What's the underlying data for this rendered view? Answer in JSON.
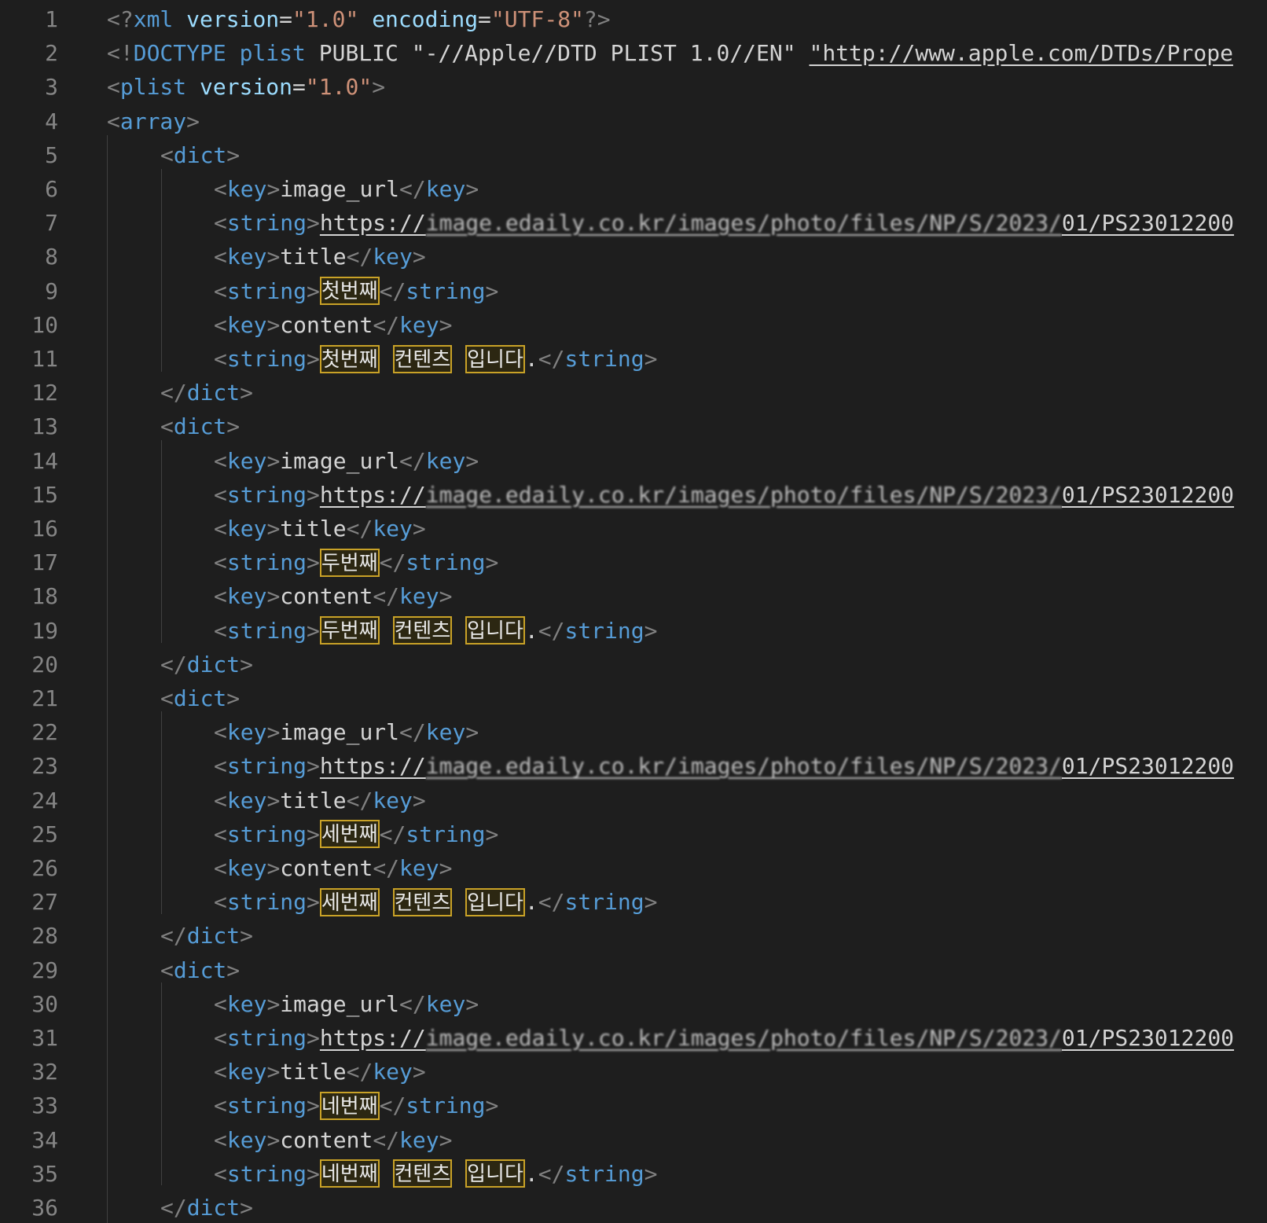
{
  "editor": {
    "language": "xml",
    "colors": {
      "background": "#1e1e1e",
      "line_number": "#858585",
      "tag_bracket": "#808080",
      "tag_name": "#569cd6",
      "attribute_name": "#9cdcfe",
      "attribute_value": "#ce9178",
      "text": "#d4d4d4",
      "unicode_highlight_border": "#c9a227"
    },
    "line_numbers": [
      "1",
      "2",
      "3",
      "4",
      "5",
      "6",
      "7",
      "8",
      "9",
      "10",
      "11",
      "12",
      "13",
      "14",
      "15",
      "16",
      "17",
      "18",
      "19",
      "20",
      "21",
      "22",
      "23",
      "24",
      "25",
      "26",
      "27",
      "28",
      "29",
      "30",
      "31",
      "32",
      "33",
      "34",
      "35",
      "36"
    ],
    "header": {
      "xml_decl": {
        "version": "1.0",
        "encoding": "UTF-8"
      },
      "doctype_public": "\"-//Apple//DTD PLIST 1.0//EN\"",
      "doctype_url": "\"http://www.apple.com/DTDs/Prope",
      "plist_version": "1.0"
    },
    "keys": {
      "image_url": "image_url",
      "title": "title",
      "content": "content"
    },
    "entries": [
      {
        "url_start": "https://",
        "url_blurred": "image.edaily.co.kr/images/photo/files/NP/S/2023/",
        "url_end": "01/PS23012200",
        "title": "첫번째",
        "content_words": [
          "첫번째",
          "컨텐츠",
          "입니다"
        ],
        "content_end": "."
      },
      {
        "url_start": "https://",
        "url_blurred": "image.edaily.co.kr/images/photo/files/NP/S/2023/",
        "url_end": "01/PS23012200",
        "title": "두번째",
        "content_words": [
          "두번째",
          "컨텐츠",
          "입니다"
        ],
        "content_end": "."
      },
      {
        "url_start": "https://",
        "url_blurred": "image.edaily.co.kr/images/photo/files/NP/S/2023/",
        "url_end": "01/PS23012200",
        "title": "세번째",
        "content_words": [
          "세번째",
          "컨텐츠",
          "입니다"
        ],
        "content_end": "."
      },
      {
        "url_start": "https://",
        "url_blurred": "image.edaily.co.kr/images/photo/files/NP/S/2023/",
        "url_end": "01/PS23012200",
        "title": "네번째",
        "content_words": [
          "네번째",
          "컨텐츠",
          "입니다"
        ],
        "content_end": "."
      }
    ]
  }
}
